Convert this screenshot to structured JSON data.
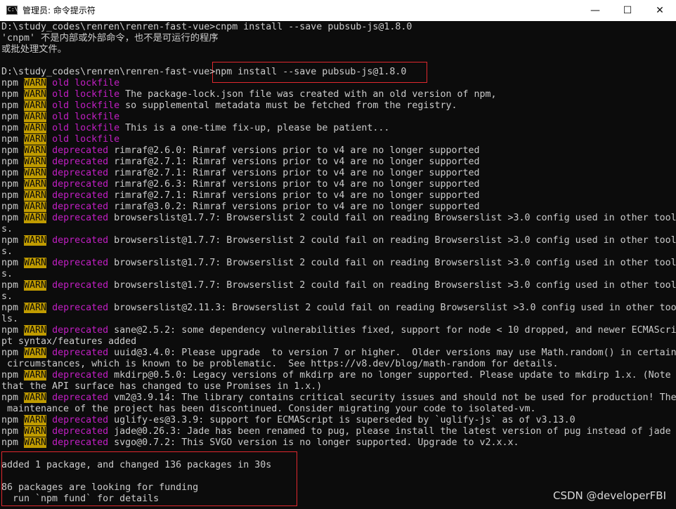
{
  "window": {
    "title": "管理员: 命令提示符",
    "icon_text": "C:\\",
    "min_glyph": "—",
    "max_glyph": "☐",
    "close_glyph": "✕"
  },
  "console": {
    "lines": [
      {
        "segments": [
          {
            "t": "D:\\study_codes\\renren\\renren-fast-vue>cnpm install --save pubsub-js@1.8.0",
            "s": "n"
          }
        ]
      },
      {
        "segments": [
          {
            "t": "'cnpm' 不是内部或外部命令，也不是可运行的程序",
            "s": "n"
          }
        ]
      },
      {
        "segments": [
          {
            "t": "或批处理文件。",
            "s": "n"
          }
        ]
      },
      {
        "segments": []
      },
      {
        "segments": [
          {
            "t": "D:\\study_codes\\renren\\renren-fast-vue>npm install --save pubsub-js@1.8.0",
            "s": "n"
          }
        ]
      },
      {
        "segments": [
          {
            "t": "npm ",
            "s": "n"
          },
          {
            "t": "WARN",
            "s": "w"
          },
          {
            "t": " old lockfile",
            "s": "m"
          }
        ]
      },
      {
        "segments": [
          {
            "t": "npm ",
            "s": "n"
          },
          {
            "t": "WARN",
            "s": "w"
          },
          {
            "t": " old lockfile",
            "s": "m"
          },
          {
            "t": " The package-lock.json file was created with an old version of npm,",
            "s": "n"
          }
        ]
      },
      {
        "segments": [
          {
            "t": "npm ",
            "s": "n"
          },
          {
            "t": "WARN",
            "s": "w"
          },
          {
            "t": " old lockfile",
            "s": "m"
          },
          {
            "t": " so supplemental metadata must be fetched from the registry.",
            "s": "n"
          }
        ]
      },
      {
        "segments": [
          {
            "t": "npm ",
            "s": "n"
          },
          {
            "t": "WARN",
            "s": "w"
          },
          {
            "t": " old lockfile",
            "s": "m"
          }
        ]
      },
      {
        "segments": [
          {
            "t": "npm ",
            "s": "n"
          },
          {
            "t": "WARN",
            "s": "w"
          },
          {
            "t": " old lockfile",
            "s": "m"
          },
          {
            "t": " This is a one-time fix-up, please be patient...",
            "s": "n"
          }
        ]
      },
      {
        "segments": [
          {
            "t": "npm ",
            "s": "n"
          },
          {
            "t": "WARN",
            "s": "w"
          },
          {
            "t": " old lockfile",
            "s": "m"
          }
        ]
      },
      {
        "segments": [
          {
            "t": "npm ",
            "s": "n"
          },
          {
            "t": "WARN",
            "s": "w"
          },
          {
            "t": " deprecated",
            "s": "m"
          },
          {
            "t": " rimraf@2.6.0: Rimraf versions prior to v4 are no longer supported",
            "s": "n"
          }
        ]
      },
      {
        "segments": [
          {
            "t": "npm ",
            "s": "n"
          },
          {
            "t": "WARN",
            "s": "w"
          },
          {
            "t": " deprecated",
            "s": "m"
          },
          {
            "t": " rimraf@2.7.1: Rimraf versions prior to v4 are no longer supported",
            "s": "n"
          }
        ]
      },
      {
        "segments": [
          {
            "t": "npm ",
            "s": "n"
          },
          {
            "t": "WARN",
            "s": "w"
          },
          {
            "t": " deprecated",
            "s": "m"
          },
          {
            "t": " rimraf@2.7.1: Rimraf versions prior to v4 are no longer supported",
            "s": "n"
          }
        ]
      },
      {
        "segments": [
          {
            "t": "npm ",
            "s": "n"
          },
          {
            "t": "WARN",
            "s": "w"
          },
          {
            "t": " deprecated",
            "s": "m"
          },
          {
            "t": " rimraf@2.6.3: Rimraf versions prior to v4 are no longer supported",
            "s": "n"
          }
        ]
      },
      {
        "segments": [
          {
            "t": "npm ",
            "s": "n"
          },
          {
            "t": "WARN",
            "s": "w"
          },
          {
            "t": " deprecated",
            "s": "m"
          },
          {
            "t": " rimraf@2.7.1: Rimraf versions prior to v4 are no longer supported",
            "s": "n"
          }
        ]
      },
      {
        "segments": [
          {
            "t": "npm ",
            "s": "n"
          },
          {
            "t": "WARN",
            "s": "w"
          },
          {
            "t": " deprecated",
            "s": "m"
          },
          {
            "t": " rimraf@3.0.2: Rimraf versions prior to v4 are no longer supported",
            "s": "n"
          }
        ]
      },
      {
        "segments": [
          {
            "t": "npm ",
            "s": "n"
          },
          {
            "t": "WARN",
            "s": "w"
          },
          {
            "t": " deprecated",
            "s": "m"
          },
          {
            "t": " browserslist@1.7.7: Browserslist 2 could fail on reading Browserslist >3.0 config used in other tool",
            "s": "n"
          }
        ]
      },
      {
        "segments": [
          {
            "t": "s.",
            "s": "n"
          }
        ]
      },
      {
        "segments": [
          {
            "t": "npm ",
            "s": "n"
          },
          {
            "t": "WARN",
            "s": "w"
          },
          {
            "t": " deprecated",
            "s": "m"
          },
          {
            "t": " browserslist@1.7.7: Browserslist 2 could fail on reading Browserslist >3.0 config used in other tool",
            "s": "n"
          }
        ]
      },
      {
        "segments": [
          {
            "t": "s.",
            "s": "n"
          }
        ]
      },
      {
        "segments": [
          {
            "t": "npm ",
            "s": "n"
          },
          {
            "t": "WARN",
            "s": "w"
          },
          {
            "t": " deprecated",
            "s": "m"
          },
          {
            "t": " browserslist@1.7.7: Browserslist 2 could fail on reading Browserslist >3.0 config used in other tool",
            "s": "n"
          }
        ]
      },
      {
        "segments": [
          {
            "t": "s.",
            "s": "n"
          }
        ]
      },
      {
        "segments": [
          {
            "t": "npm ",
            "s": "n"
          },
          {
            "t": "WARN",
            "s": "w"
          },
          {
            "t": " deprecated",
            "s": "m"
          },
          {
            "t": " browserslist@1.7.7: Browserslist 2 could fail on reading Browserslist >3.0 config used in other tool",
            "s": "n"
          }
        ]
      },
      {
        "segments": [
          {
            "t": "s.",
            "s": "n"
          }
        ]
      },
      {
        "segments": [
          {
            "t": "npm ",
            "s": "n"
          },
          {
            "t": "WARN",
            "s": "w"
          },
          {
            "t": " deprecated",
            "s": "m"
          },
          {
            "t": " browserslist@2.11.3: Browserslist 2 could fail on reading Browserslist >3.0 config used in other too",
            "s": "n"
          }
        ]
      },
      {
        "segments": [
          {
            "t": "ls.",
            "s": "n"
          }
        ]
      },
      {
        "segments": [
          {
            "t": "npm ",
            "s": "n"
          },
          {
            "t": "WARN",
            "s": "w"
          },
          {
            "t": " deprecated",
            "s": "m"
          },
          {
            "t": " sane@2.5.2: some dependency vulnerabilities fixed, support for node < 10 dropped, and newer ECMAScri",
            "s": "n"
          }
        ]
      },
      {
        "segments": [
          {
            "t": "pt syntax/features added",
            "s": "n"
          }
        ]
      },
      {
        "segments": [
          {
            "t": "npm ",
            "s": "n"
          },
          {
            "t": "WARN",
            "s": "w"
          },
          {
            "t": " deprecated",
            "s": "m"
          },
          {
            "t": " uuid@3.4.0: Please upgrade  to version 7 or higher.  Older versions may use Math.random() in certain",
            "s": "n"
          }
        ]
      },
      {
        "segments": [
          {
            "t": " circumstances, which is known to be problematic.  See https://v8.dev/blog/math-random for details.",
            "s": "n"
          }
        ]
      },
      {
        "segments": [
          {
            "t": "npm ",
            "s": "n"
          },
          {
            "t": "WARN",
            "s": "w"
          },
          {
            "t": " deprecated",
            "s": "m"
          },
          {
            "t": " mkdirp@0.5.0: Legacy versions of mkdirp are no longer supported. Please update to mkdirp 1.x. (Note",
            "s": "n"
          }
        ]
      },
      {
        "segments": [
          {
            "t": "that the API surface has changed to use Promises in 1.x.)",
            "s": "n"
          }
        ]
      },
      {
        "segments": [
          {
            "t": "npm ",
            "s": "n"
          },
          {
            "t": "WARN",
            "s": "w"
          },
          {
            "t": " deprecated",
            "s": "m"
          },
          {
            "t": " vm2@3.9.14: The library contains critical security issues and should not be used for production! The",
            "s": "n"
          }
        ]
      },
      {
        "segments": [
          {
            "t": " maintenance of the project has been discontinued. Consider migrating your code to isolated-vm.",
            "s": "n"
          }
        ]
      },
      {
        "segments": [
          {
            "t": "npm ",
            "s": "n"
          },
          {
            "t": "WARN",
            "s": "w"
          },
          {
            "t": " deprecated",
            "s": "m"
          },
          {
            "t": " uglify-es@3.3.9: support for ECMAScript is superseded by `uglify-js` as of v3.13.0",
            "s": "n"
          }
        ]
      },
      {
        "segments": [
          {
            "t": "npm ",
            "s": "n"
          },
          {
            "t": "WARN",
            "s": "w"
          },
          {
            "t": " deprecated",
            "s": "m"
          },
          {
            "t": " jade@0.26.3: Jade has been renamed to pug, please install the latest version of pug instead of jade",
            "s": "n"
          }
        ]
      },
      {
        "segments": [
          {
            "t": "npm ",
            "s": "n"
          },
          {
            "t": "WARN",
            "s": "w"
          },
          {
            "t": " deprecated",
            "s": "m"
          },
          {
            "t": " svgo@0.7.2: This SVGO version is no longer supported. Upgrade to v2.x.x.",
            "s": "n"
          }
        ]
      },
      {
        "segments": []
      },
      {
        "segments": [
          {
            "t": "added 1 package, and changed 136 packages in 30s",
            "s": "n"
          }
        ]
      },
      {
        "segments": []
      },
      {
        "segments": [
          {
            "t": "86 packages are looking for funding",
            "s": "n"
          }
        ]
      },
      {
        "segments": [
          {
            "t": "  run `npm fund` for details",
            "s": "n"
          }
        ]
      }
    ]
  },
  "colors": {
    "background": "#0c0c0c",
    "text": "#cccccc",
    "warn_bg": "#c19c00",
    "magenta": "#c21fc4",
    "highlight_border": "#e0282e"
  },
  "watermark": "CSDN @developerFBI"
}
